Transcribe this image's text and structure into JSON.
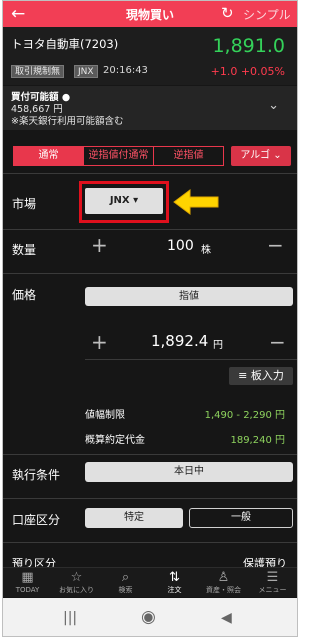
{
  "header": {
    "back_icon": "arrow-left-icon",
    "title": "現物買い",
    "refresh_icon": "refresh-icon",
    "simple_label": "シンプル"
  },
  "stock": {
    "name": "トヨタ自動車(7203)",
    "price": "1,891.0",
    "tag_restriction": "取引規制無",
    "tag_market": "JNX",
    "time": "20:16:43",
    "change": "+1.0",
    "change_pct": "+0.05%"
  },
  "buying_power": {
    "label": "買付可能額",
    "amount": "458,667 円",
    "note": "※楽天銀行利用可能額含む"
  },
  "order_tabs": [
    "通常",
    "逆指値付通常",
    "逆指値"
  ],
  "algo_label": "アルゴ",
  "market": {
    "label": "市場",
    "value": "JNX"
  },
  "quantity": {
    "label": "数量",
    "value": "100",
    "unit": "株"
  },
  "price": {
    "label": "価格",
    "type": "指値",
    "value": "1,892.4",
    "unit": "円",
    "board_button": "板入力"
  },
  "limits": {
    "label": "値幅制限",
    "value": "1,490 - 2,290 円"
  },
  "estimate": {
    "label": "概算約定代金",
    "value": "189,240 円"
  },
  "condition": {
    "label": "執行条件",
    "value": "本日中"
  },
  "account": {
    "label": "口座区分",
    "options": [
      "特定",
      "一般"
    ]
  },
  "custody": {
    "label": "預り区分",
    "value": "保護預り"
  },
  "bottom_nav": [
    {
      "label": "TODAY",
      "icon": "calendar-icon"
    },
    {
      "label": "お気に入り",
      "icon": "star-icon"
    },
    {
      "label": "検索",
      "icon": "search-icon"
    },
    {
      "label": "注文",
      "icon": "order-icon"
    },
    {
      "label": "資産・照会",
      "icon": "person-icon"
    },
    {
      "label": "メニュー",
      "icon": "menu-icon"
    }
  ],
  "colors": {
    "accent": "#f23e55",
    "up": "#34d25a",
    "down": "#ff3b4e",
    "highlight": "#e0101d",
    "arrow": "#ffd400"
  }
}
